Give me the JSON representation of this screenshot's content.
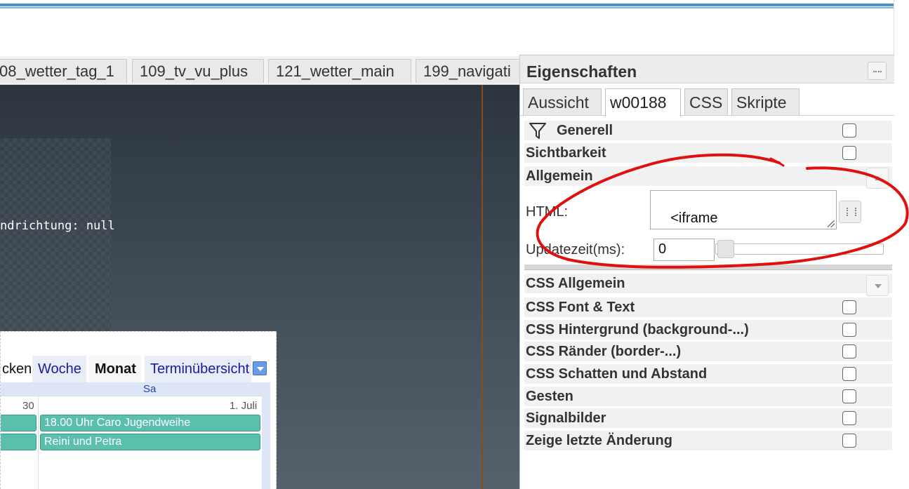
{
  "view_tabs": [
    {
      "label": "08_wetter_tag_1"
    },
    {
      "label": "109_tv_vu_plus"
    },
    {
      "label": "121_wetter_main"
    },
    {
      "label": "199_navigati"
    }
  ],
  "canvas": {
    "wind_text": "ndrichtung: null"
  },
  "calendar": {
    "tabs": {
      "partial": "cken",
      "week": "Woche",
      "month": "Monat",
      "agenda": "Terminübersicht"
    },
    "weekday_header": "Sa",
    "day_prev": "30",
    "day_current": "1. Juli",
    "events": [
      {
        "title": "18.00 Uhr Caro Jugendweihe"
      },
      {
        "title": "Reini und Petra"
      }
    ],
    "colors": {
      "event": "#5bbfae",
      "header": "#dde6f7"
    }
  },
  "properties_panel": {
    "title": "Eigenschaften",
    "tabs": [
      "Aussicht",
      "w00188",
      "CSS",
      "Skripte"
    ],
    "active_tab": "w00188",
    "groups": {
      "generell": "Generell",
      "sichtbarkeit": "Sichtbarkeit",
      "allgemein": "Allgemein"
    },
    "html_label": "HTML:",
    "html_value": "<iframe\nsrc=\"https://calendar.g",
    "update_label": "Updatezeit(ms):",
    "update_value": "0",
    "css_groups": {
      "allgemein": "CSS Allgemein",
      "font": "CSS Font & Text",
      "hintergrund": "CSS Hintergrund (background-...)",
      "raender": "CSS Ränder (border-...)",
      "schatten": "CSS Schatten und Abstand",
      "gesten": "Gesten",
      "signalbilder": "Signalbilder",
      "letzte": "Zeige letzte Änderung"
    }
  },
  "annotation": {
    "color": "#e01010"
  },
  "icons": [
    "filter-icon",
    "panel-menu-icon",
    "edit-html-icon",
    "chevron-up-icon",
    "chevron-down-icon",
    "dropdown-icon"
  ]
}
